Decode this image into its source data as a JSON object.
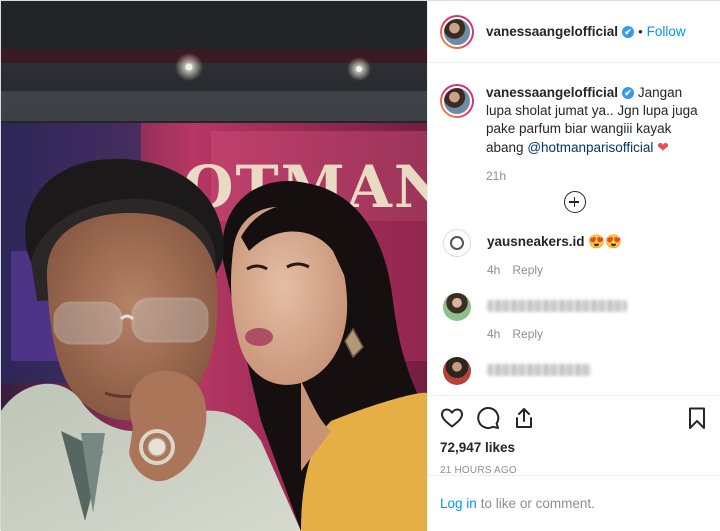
{
  "post": {
    "username": "vanessaangelofficial",
    "verified_badge": "✔",
    "dot": "•",
    "follow_label": "Follow"
  },
  "caption": {
    "username": "vanessaangelofficial",
    "text": "Jangan lupa sholat jumat ya.. Jgn lupa juga pake parfum biar wangiii kayak abang",
    "mention": "@hotmanparisofficial",
    "heart": "❤",
    "time": "21h"
  },
  "photo": {
    "backdrop_text": "OTMAN"
  },
  "comments": [
    {
      "username": "yausneakers.id",
      "text": "😍😍",
      "time": "4h",
      "reply_label": "Reply"
    },
    {
      "username": "",
      "text": "",
      "time": "4h",
      "reply_label": "Reply"
    },
    {
      "username": "",
      "text": "",
      "time": "",
      "reply_label": ""
    }
  ],
  "actions": {
    "likes": "72,947 likes",
    "timestamp": "21 HOURS AGO"
  },
  "footer": {
    "login_label": "Log in",
    "login_suffix": "to like or comment."
  },
  "icons": {
    "like": "heart-icon",
    "comment": "comment-icon",
    "share": "share-icon",
    "save": "bookmark-icon",
    "load_more": "plus-circle-icon"
  },
  "colors": {
    "link": "#0095f6",
    "heart": "#ed4956",
    "verified": "#3897f0",
    "muted": "#8e8e8e"
  }
}
